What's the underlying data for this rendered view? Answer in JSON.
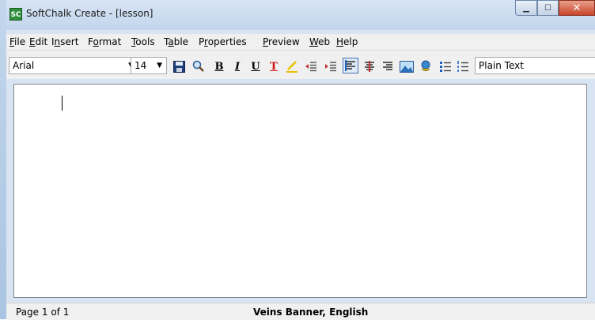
{
  "window": {
    "app_icon_text": "SC",
    "title": "SoftChalk Create - [lesson]",
    "minimize_glyph": "▁",
    "maximize_glyph": "☐",
    "close_glyph": "✕"
  },
  "menu": {
    "items": [
      {
        "pre": "",
        "u": "F",
        "post": "ile"
      },
      {
        "pre": "",
        "u": "E",
        "post": "dit"
      },
      {
        "pre": "I",
        "u": "n",
        "post": "sert"
      },
      {
        "pre": "F",
        "u": "o",
        "post": "rmat"
      },
      {
        "pre": "",
        "u": "T",
        "post": "ools"
      },
      {
        "pre": "T",
        "u": "a",
        "post": "ble"
      },
      {
        "pre": "P",
        "u": "r",
        "post": "operties"
      },
      {
        "pre": "",
        "u": "P",
        "post": "review"
      },
      {
        "pre": "",
        "u": "W",
        "post": "eb"
      },
      {
        "pre": "",
        "u": "H",
        "post": "elp"
      }
    ]
  },
  "toolbar": {
    "font_name": "Arial",
    "font_size": "14",
    "style_select": "Plain Text",
    "bold_label": "B",
    "italic_label": "I",
    "underline_label": "U",
    "text_color_label": "T",
    "icons": [
      "save-icon",
      "spellcheck-icon",
      "bold-icon",
      "italic-icon",
      "underline-icon",
      "text-color-icon",
      "highlight-icon",
      "outdent-icon",
      "indent-icon",
      "align-left-icon",
      "align-center-icon",
      "align-right-icon",
      "insert-image-icon",
      "insert-media-icon",
      "bullet-list-icon",
      "numbered-list-icon"
    ],
    "colors": {
      "text_color": "#d01010",
      "highlight": "#e8c000",
      "accent": "#1b5fbf"
    }
  },
  "status": {
    "page": "Page 1 of 1",
    "banner": "Veins Banner, English"
  }
}
